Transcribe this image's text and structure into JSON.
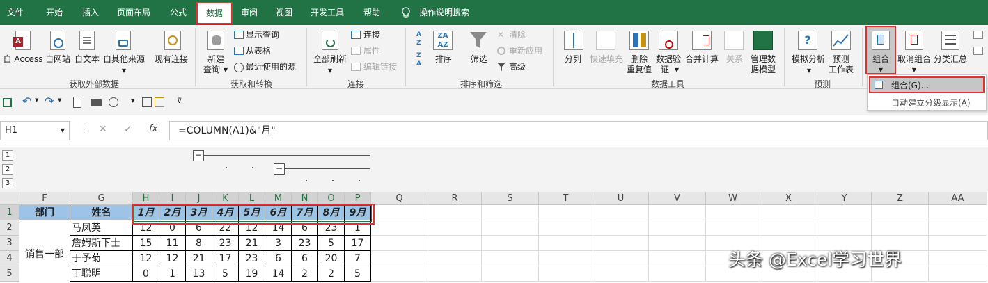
{
  "menu": {
    "tabs": [
      "文件",
      "开始",
      "插入",
      "页面布局",
      "公式",
      "数据",
      "审阅",
      "视图",
      "开发工具",
      "帮助"
    ],
    "tell_me": "操作说明搜索",
    "active": "数据"
  },
  "ribbon": {
    "external": {
      "access": "自 Access",
      "web": "自网站",
      "text": "自文本",
      "other": "自其他来源",
      "existing": "现有连接",
      "label": "获取外部数据"
    },
    "transform": {
      "new_query_1": "新建",
      "new_query_2": "查询",
      "show_queries": "显示查询",
      "from_table": "从表格",
      "recent_sources": "最近使用的源",
      "label": "获取和转换"
    },
    "connections": {
      "refresh_all": "全部刷新",
      "connections": "连接",
      "properties": "属性",
      "edit_links": "编辑链接",
      "label": "连接"
    },
    "sortfilter": {
      "sort": "排序",
      "filter": "筛选",
      "clear": "清除",
      "reapply": "重新应用",
      "advanced": "高级",
      "label": "排序和筛选"
    },
    "datatools": {
      "split": "分列",
      "flash_fill": "快速填充",
      "remove_dup_1": "删除",
      "remove_dup_2": "重复值",
      "validation_1": "数据验",
      "validation_2": "证",
      "consolidate": "合并计算",
      "relationships": "关系",
      "data_model_1": "管理数",
      "data_model_2": "据模型",
      "label": "数据工具"
    },
    "forecast": {
      "whatif": "模拟分析",
      "forecast_1": "预测",
      "forecast_2": "工作表",
      "label": "预测"
    },
    "outline": {
      "group": "组合",
      "ungroup": "取消组合",
      "subtotal": "分类汇总"
    }
  },
  "dropdown": {
    "item1": "组合(G)...",
    "item2": "自动建立分级显示(A)"
  },
  "formula_bar": {
    "name_box": "H1",
    "formula": "=COLUMN(A1)&\"月\"",
    "fx": "fx"
  },
  "outline_levels": [
    "1",
    "2",
    "3"
  ],
  "columns": [
    "F",
    "G",
    "H",
    "I",
    "J",
    "K",
    "L",
    "M",
    "N",
    "O",
    "P",
    "Q",
    "R",
    "S",
    "T",
    "U",
    "V",
    "W",
    "X",
    "Y",
    "Z",
    "AA"
  ],
  "rows": [
    "1",
    "2",
    "3",
    "4",
    "5"
  ],
  "table": {
    "header_dept": "部门",
    "header_name": "姓名",
    "months": [
      "1月",
      "2月",
      "3月",
      "4月",
      "5月",
      "6月",
      "7月",
      "8月",
      "9月"
    ],
    "dept": "销售一部",
    "names": [
      "马凤英",
      "詹姆斯下士",
      "于予菊",
      "丁聪明"
    ],
    "values": [
      [
        12,
        0,
        6,
        22,
        12,
        14,
        6,
        23,
        1
      ],
      [
        15,
        11,
        8,
        23,
        21,
        3,
        23,
        5,
        17
      ],
      [
        12,
        12,
        21,
        17,
        23,
        6,
        6,
        20,
        7
      ],
      [
        0,
        1,
        13,
        5,
        19,
        14,
        2,
        2,
        5
      ]
    ]
  },
  "watermark": "头条 @Excel学习世界",
  "colors": {
    "excel_green": "#217346",
    "header_fill": "#9dc3e6",
    "highlight_red": "#e03030"
  }
}
